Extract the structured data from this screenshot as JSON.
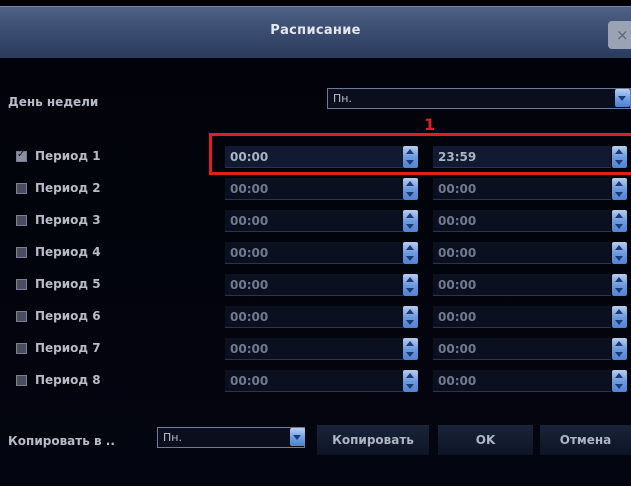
{
  "window": {
    "title": "Расписание",
    "close_glyph": "×"
  },
  "weekday": {
    "label": "День недели",
    "value": "Пн."
  },
  "annotation": {
    "marker": "1",
    "color": "#e0201f"
  },
  "periods": [
    {
      "label": "Период 1",
      "checked": true,
      "start": "00:00",
      "end": "23:59"
    },
    {
      "label": "Период 2",
      "checked": false,
      "start": "00:00",
      "end": "00:00"
    },
    {
      "label": "Период 3",
      "checked": false,
      "start": "00:00",
      "end": "00:00"
    },
    {
      "label": "Период 4",
      "checked": false,
      "start": "00:00",
      "end": "00:00"
    },
    {
      "label": "Период 5",
      "checked": false,
      "start": "00:00",
      "end": "00:00"
    },
    {
      "label": "Период 6",
      "checked": false,
      "start": "00:00",
      "end": "00:00"
    },
    {
      "label": "Период 7",
      "checked": false,
      "start": "00:00",
      "end": "00:00"
    },
    {
      "label": "Период 8",
      "checked": false,
      "start": "00:00",
      "end": "00:00"
    }
  ],
  "copy": {
    "label": "Копировать в ..",
    "value": "Пн."
  },
  "buttons": {
    "copy": "Копировать",
    "ok": "OK",
    "cancel": "Отмена"
  },
  "colors": {
    "title_bar": "#3b4d71",
    "background": "#000004",
    "spinner": "#6d9be0"
  }
}
